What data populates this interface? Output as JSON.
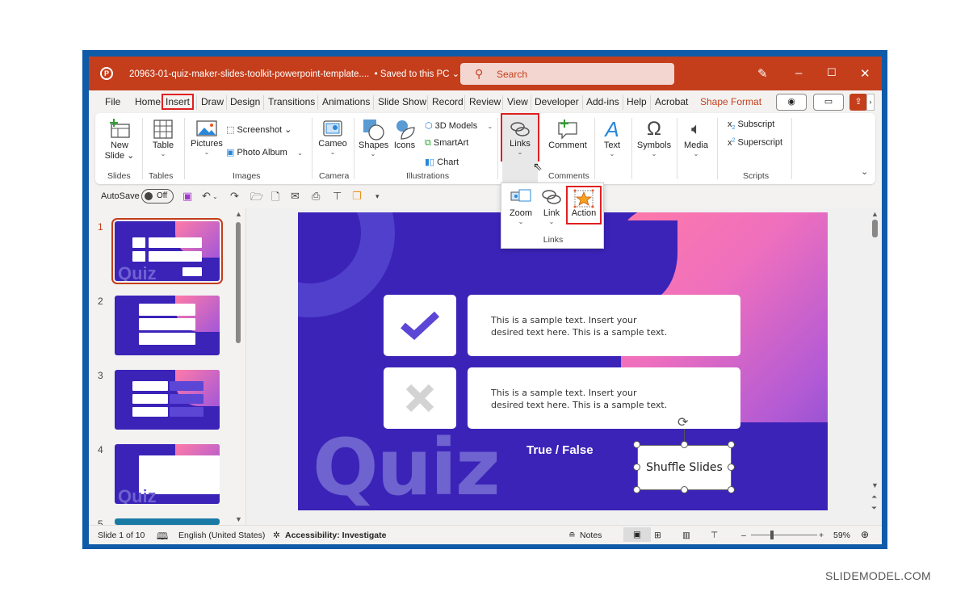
{
  "titlebar": {
    "filename": "20963-01-quiz-maker-slides-toolkit-powerpoint-template....",
    "saved_status": "• Saved to this PC ⌄",
    "search_placeholder": "Search"
  },
  "tabs": [
    "File",
    "Home",
    "Insert",
    "Draw",
    "Design",
    "Transitions",
    "Animations",
    "Slide Show",
    "Record",
    "Review",
    "View",
    "Developer",
    "Add-ins",
    "Help",
    "Acrobat",
    "Shape Format"
  ],
  "active_tab": "Insert",
  "ribbon": {
    "slides": {
      "new_slide": "New",
      "new_slide2": "Slide ⌄",
      "group": "Slides"
    },
    "tables": {
      "table": "Table",
      "group": "Tables"
    },
    "images": {
      "pictures": "Pictures",
      "screenshot": "Screenshot ⌄",
      "photo_album": "Photo Album",
      "group": "Images"
    },
    "camera": {
      "cameo": "Cameo",
      "group": "Camera"
    },
    "illustrations": {
      "shapes": "Shapes",
      "icons": "Icons",
      "models": "3D Models",
      "smartart": "SmartArt",
      "chart": "Chart",
      "group": "Illustrations"
    },
    "links": {
      "links": "Links"
    },
    "comments": {
      "comment": "Comment",
      "group": "Comments"
    },
    "text": {
      "text": "Text"
    },
    "symbols": {
      "symbols": "Symbols"
    },
    "media": {
      "media": "Media"
    },
    "scripts": {
      "subscript": "Subscript",
      "superscript": "Superscript",
      "group": "Scripts"
    }
  },
  "links_dropdown": {
    "zoom": "Zoom",
    "link": "Link",
    "action": "Action",
    "group": "Links"
  },
  "qat": {
    "autosave": "AutoSave",
    "toggle": "Off"
  },
  "thumbnails": [
    {
      "num": "1",
      "selected": true
    },
    {
      "num": "2",
      "selected": false
    },
    {
      "num": "3",
      "selected": false
    },
    {
      "num": "4",
      "selected": false
    },
    {
      "num": "5",
      "selected": false
    }
  ],
  "slide": {
    "text1_line1": "This is a sample text. Insert your",
    "text1_line2": "desired text here. This is a sample text.",
    "text2_line1": "This is a sample text. Insert your",
    "text2_line2": "desired text here. This is a sample text.",
    "quiz": "Quiz",
    "true_false": "True / False",
    "shuffle": "Shuffle Slides",
    "thumb_quiz": "Quiz"
  },
  "status": {
    "slide_count": "Slide 1 of 10",
    "language": "English (United States)",
    "accessibility": "Accessibility: Investigate",
    "notes": "Notes",
    "zoom": "59%"
  },
  "watermark": "SLIDEMODEL.COM",
  "colors": {
    "accent": "#c43e1c",
    "slide_bg": "#3b23b8",
    "highlight": "#e02020"
  }
}
